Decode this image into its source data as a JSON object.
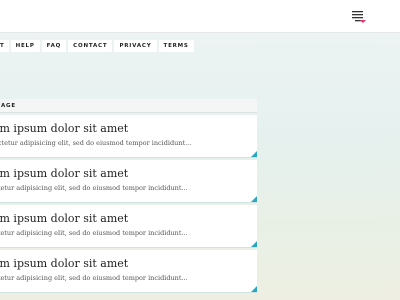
{
  "header": {
    "menu_icon": "menu-lines-icon",
    "accent_color": "#e8326e"
  },
  "nav": {
    "items": [
      {
        "label": "T"
      },
      {
        "label": "HELP"
      },
      {
        "label": "FAQ"
      },
      {
        "label": "CONTACT"
      },
      {
        "label": "PRIVACY"
      },
      {
        "label": "TERMS"
      }
    ]
  },
  "list": {
    "header": "AGE",
    "items": [
      {
        "title": "em ipsum dolor sit amet",
        "text": "ectetur adipisicing elit, sed do eiusmod tempor incididunt..."
      },
      {
        "title": "em ipsum dolor sit amet",
        "text": "etetur adipisicing elit, sed do eiusmod tempor incididunt..."
      },
      {
        "title": "em ipsum dolor sit amet",
        "text": "etetur adipisicing elit, sed do eiusmod tempor incididunt..."
      },
      {
        "title": "em ipsum dolor sit amet",
        "text": "etetur adipisicing elit, sed do eiusmod tempor incididunt..."
      }
    ],
    "corner_color": "#2aa7bf"
  }
}
